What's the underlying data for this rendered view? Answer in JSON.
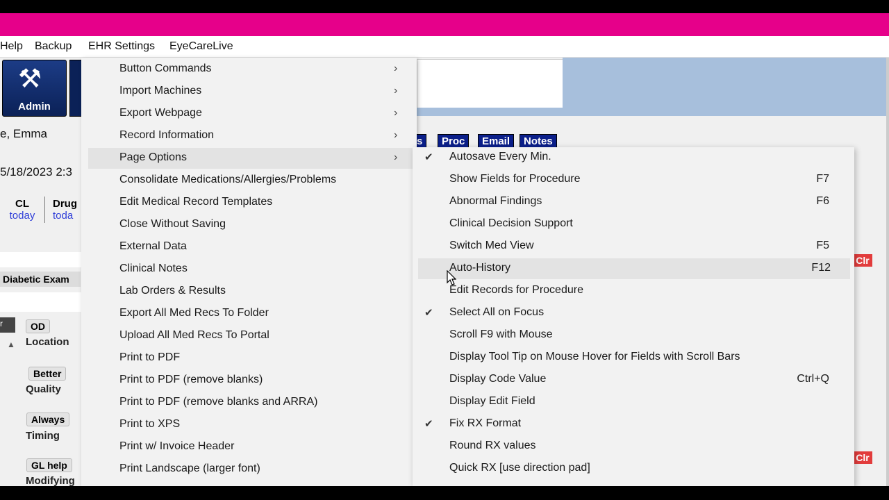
{
  "menubar": [
    "Help",
    "Backup",
    "EHR Settings",
    "EyeCareLive"
  ],
  "app": {
    "admin_label": "Admin",
    "patient_name": "e, Emma",
    "date_time": "5/18/2023  2:3",
    "cl_label": "CL",
    "cl_sub": "today",
    "drug_label": "Drug",
    "drug_sub": "toda",
    "diabetic_exam": "Diabetic Exam",
    "od": "OD",
    "location": "Location",
    "better": "Better",
    "quality": "Quality",
    "always": "Always",
    "timing": "Timing",
    "gl_help": "GL help",
    "modifying": "Modifying",
    "left_r": "r",
    "tabs": [
      "s",
      "Proc",
      "Email",
      "Notes"
    ],
    "clr": "Clr"
  },
  "ehr_menu": [
    {
      "label": "Button Commands",
      "submenu": true
    },
    {
      "label": "Import Machines",
      "submenu": true
    },
    {
      "label": "Export Webpage",
      "submenu": true
    },
    {
      "label": "Record Information",
      "submenu": true
    },
    {
      "label": "Page Options",
      "submenu": true,
      "highlighted": true
    },
    {
      "label": "Consolidate Medications/Allergies/Problems"
    },
    {
      "label": "Edit Medical Record Templates"
    },
    {
      "label": "Close Without Saving"
    },
    {
      "label": "External Data"
    },
    {
      "label": "Clinical Notes"
    },
    {
      "label": "Lab Orders & Results"
    },
    {
      "label": "Export All Med Recs To Folder"
    },
    {
      "label": "Upload All Med Recs To Portal"
    },
    {
      "label": "Print to PDF"
    },
    {
      "label": "Print to PDF (remove blanks)"
    },
    {
      "label": "Print to PDF (remove blanks and ARRA)"
    },
    {
      "label": "Print to XPS"
    },
    {
      "label": "Print w/ Invoice Header"
    },
    {
      "label": "Print Landscape (larger font)"
    }
  ],
  "page_options_menu": [
    {
      "label": "Autosave Every Min.",
      "checked": true,
      "shortcut": ""
    },
    {
      "label": "Show Fields for Procedure",
      "shortcut": "F7"
    },
    {
      "label": "Abnormal Findings",
      "shortcut": "F6"
    },
    {
      "label": "Clinical Decision Support",
      "shortcut": ""
    },
    {
      "label": "Switch Med View",
      "shortcut": "F5"
    },
    {
      "label": "Auto-History",
      "shortcut": "F12",
      "hovered": true
    },
    {
      "label": "Edit Records for Procedure",
      "shortcut": ""
    },
    {
      "label": "Select All on Focus",
      "checked": true,
      "shortcut": ""
    },
    {
      "label": "Scroll F9 with Mouse",
      "shortcut": ""
    },
    {
      "label": "Display Tool Tip on Mouse Hover for Fields with Scroll Bars",
      "shortcut": ""
    },
    {
      "label": "Display Code Value",
      "shortcut": "Ctrl+Q"
    },
    {
      "label": "Display Edit Field",
      "shortcut": ""
    },
    {
      "label": "Fix RX Format",
      "checked": true,
      "shortcut": ""
    },
    {
      "label": "Round RX values",
      "shortcut": ""
    },
    {
      "label": "Quick RX [use direction pad]",
      "shortcut": ""
    }
  ]
}
